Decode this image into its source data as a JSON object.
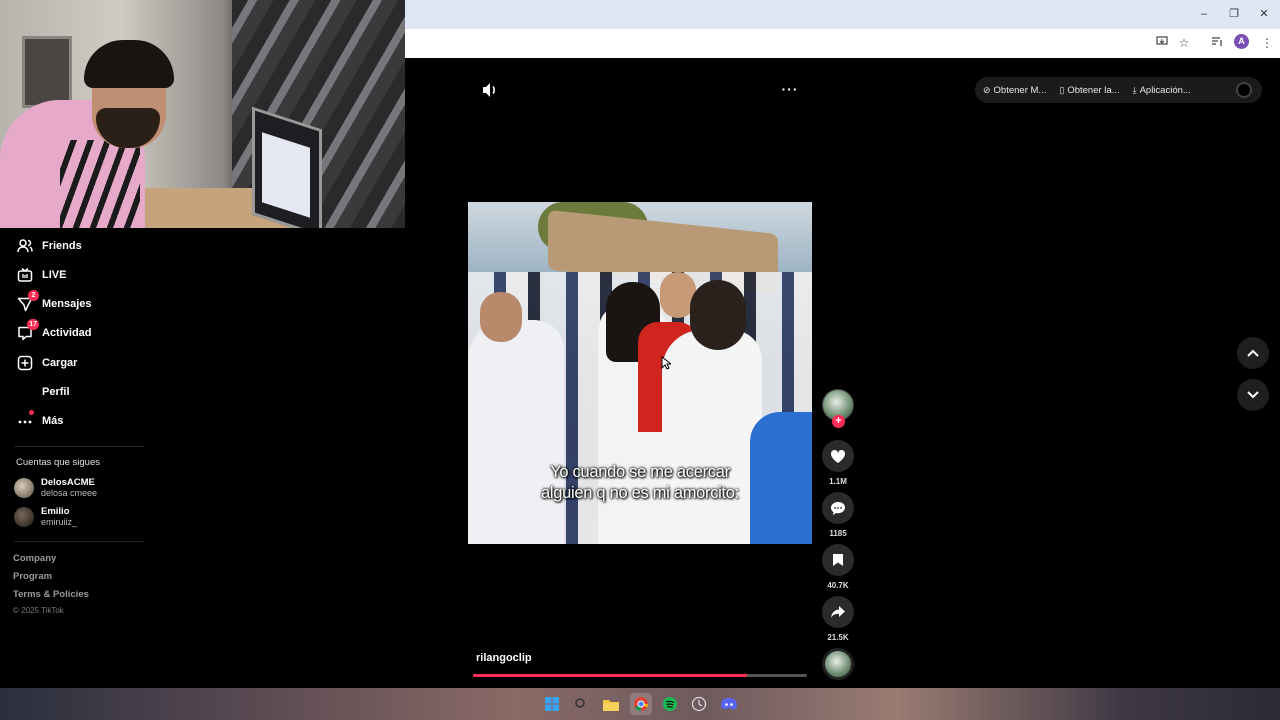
{
  "browser": {
    "window_controls": [
      "–",
      "❐",
      "✕"
    ],
    "profile_initial": "A"
  },
  "sidebar": {
    "items": [
      {
        "label": "Friends",
        "icon": "friends-icon"
      },
      {
        "label": "LIVE",
        "icon": "live-icon"
      },
      {
        "label": "Mensajes",
        "icon": "messages-icon",
        "badge": "2"
      },
      {
        "label": "Actividad",
        "icon": "activity-icon",
        "badge": "17"
      },
      {
        "label": "Cargar",
        "icon": "upload-icon"
      },
      {
        "label": "Perfil",
        "icon": "profile-icon"
      },
      {
        "label": "Más",
        "icon": "more-icon"
      }
    ],
    "following_title": "Cuentas que sigues",
    "following": [
      {
        "name": "DelosACME",
        "handle": "delosa cmeee"
      },
      {
        "name": "Emilio",
        "handle": "emiruiiz_"
      }
    ],
    "footer": [
      "Company",
      "Program",
      "Terms & Policies"
    ],
    "copyright": "© 2025 TikTok"
  },
  "top_actions": [
    {
      "label": "Obtener M...",
      "icon": "coin-icon"
    },
    {
      "label": "Obtener la...",
      "icon": "phone-icon"
    },
    {
      "label": "Aplicación...",
      "icon": "download-icon"
    }
  ],
  "video": {
    "caption_line1": "Yo cuando se me acercar",
    "caption_line2": "alguien q no es mi amorcito:",
    "author": "rilangoclip",
    "progress": 0.82
  },
  "actions": {
    "likes": "1.1M",
    "comments": "1185",
    "saves": "40.7K",
    "shares": "21.5K"
  },
  "colors": {
    "accent": "#fe2c55",
    "background": "#000000"
  }
}
